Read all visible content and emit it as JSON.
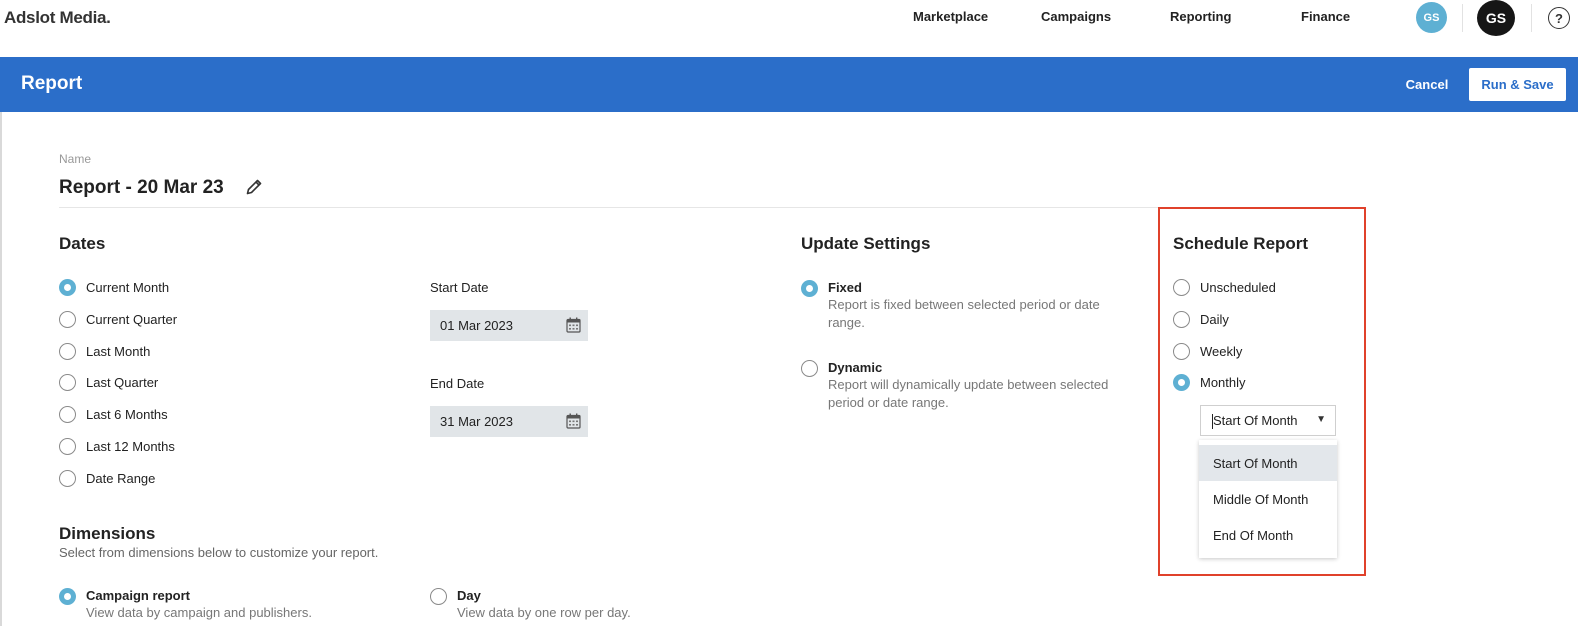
{
  "nav": {
    "brand": "Adslot Media.",
    "links": [
      "Marketplace",
      "Campaigns",
      "Reporting",
      "Finance"
    ],
    "avatar_light": "GS",
    "avatar_dark": "GS",
    "help": "?"
  },
  "header": {
    "title": "Report",
    "cancel_label": "Cancel",
    "run_save_label": "Run & Save"
  },
  "name_section": {
    "label": "Name",
    "value": "Report - 20 Mar 23"
  },
  "dates": {
    "title": "Dates",
    "options": [
      "Current Month",
      "Current Quarter",
      "Last Month",
      "Last Quarter",
      "Last 6 Months",
      "Last 12 Months",
      "Date Range"
    ],
    "selected": "Current Month",
    "start_label": "Start Date",
    "start_value": "01 Mar 2023",
    "end_label": "End Date",
    "end_value": "31 Mar 2023"
  },
  "update_settings": {
    "title": "Update Settings",
    "fixed_title": "Fixed",
    "fixed_desc": "Report is fixed between selected period or date range.",
    "dynamic_title": "Dynamic",
    "dynamic_desc": "Report will dynamically update between selected period or date range.",
    "selected": "Fixed"
  },
  "schedule": {
    "title": "Schedule Report",
    "options": [
      "Unscheduled",
      "Daily",
      "Weekly",
      "Monthly"
    ],
    "selected": "Monthly",
    "select_value": "Start Of Month",
    "dropdown_options": [
      "Start Of Month",
      "Middle Of Month",
      "End Of Month"
    ],
    "highlight_color": "#e0412b"
  },
  "dimensions": {
    "title": "Dimensions",
    "subtitle": "Select from dimensions below to customize your report.",
    "campaign_title": "Campaign report",
    "campaign_desc": "View data by campaign and publishers.",
    "day_title": "Day",
    "day_desc": "View data by one row per day.",
    "selected": "Campaign report"
  },
  "colors": {
    "header_blue": "#2b6ec9",
    "radio_accent": "#5eb0d3"
  }
}
